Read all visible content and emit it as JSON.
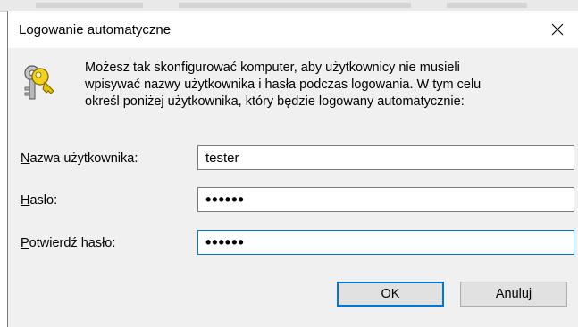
{
  "dialog": {
    "title": "Logowanie automatyczne",
    "message_lines": [
      "Możesz tak skonfigurować komputer, aby użytkownicy nie musieli",
      "wpisywać nazwy użytkownika i hasła podczas logowania. W tym celu",
      "określ poniżej użytkownika, który będzie logowany automatycznie:"
    ],
    "fields": {
      "username": {
        "label_key": "N",
        "label_rest": "azwa użytkownika:",
        "value": "tester"
      },
      "password": {
        "label_key": "H",
        "label_rest": "asło:",
        "value": "••••••"
      },
      "confirm": {
        "label_key": "P",
        "label_rest": "otwierdź hasło:",
        "value": "••••••"
      }
    },
    "buttons": {
      "ok": "OK",
      "cancel": "Anuluj"
    },
    "icons": {
      "close": "close-icon",
      "keys": "keys-icon"
    },
    "colors": {
      "accent": "#0078d7",
      "face": "#f0f0f0",
      "button": "#e1e1e1"
    }
  }
}
